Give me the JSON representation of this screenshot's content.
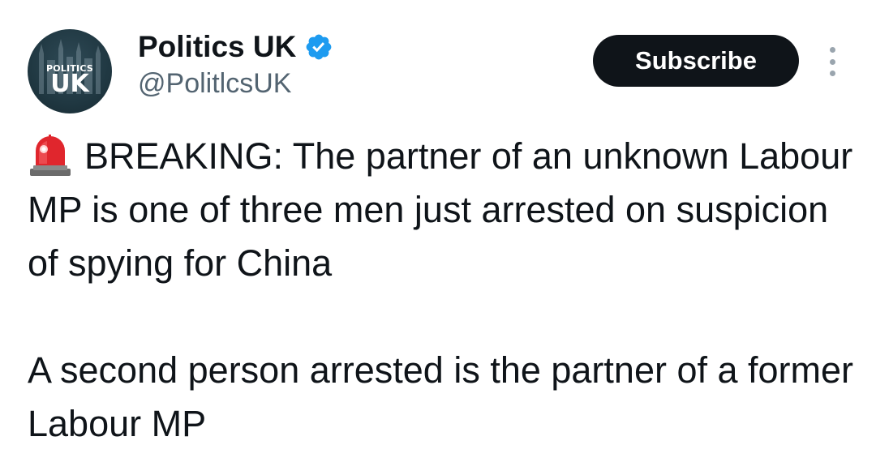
{
  "account": {
    "display_name": "Politics UK",
    "handle": "@PolitlcsUK",
    "verified": true,
    "avatar": {
      "logo_top": "POLITICS",
      "logo_bottom": "UK",
      "background_color": "#203842"
    }
  },
  "actions": {
    "subscribe_label": "Subscribe",
    "more_icon": "more-vertical-icon"
  },
  "tweet": {
    "emoji": "police-siren-icon",
    "paragraphs": [
      "BREAKING: The partner of an unknown Labour MP is one of three men just arrested on suspicion of spying for China",
      "A second person arrested is the partner of a former Labour MP"
    ]
  },
  "colors": {
    "text_primary": "#0f1419",
    "text_secondary": "#536471",
    "verified_blue": "#1d9bf0",
    "button_bg": "#0f1419",
    "button_text": "#ffffff"
  }
}
